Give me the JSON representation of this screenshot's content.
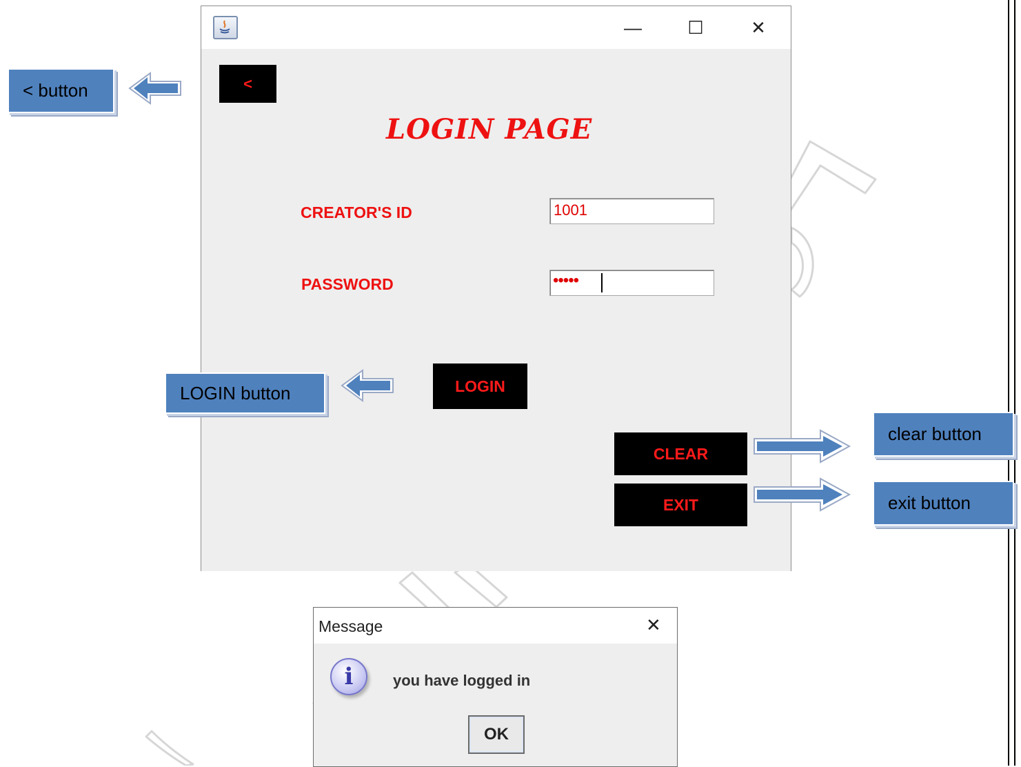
{
  "window": {
    "title": "",
    "back_label": "<",
    "heading": "LOGIN PAGE",
    "creator_id_label": "CREATOR'S ID",
    "creator_id_value": "1001",
    "password_label": "PASSWORD",
    "password_mask": "•••••",
    "login_label": "LOGIN",
    "clear_label": "CLEAR",
    "exit_label": "EXIT",
    "controls": {
      "minimize": "—",
      "maximize": "☐",
      "close": "✕"
    }
  },
  "callouts": {
    "back": "< button",
    "login": "LOGIN  button",
    "clear": "clear button",
    "exit": "exit button"
  },
  "dialog": {
    "title": "Message",
    "message": "you have logged in",
    "ok_label": "OK",
    "close": "✕"
  },
  "colors": {
    "accent_red": "#ee1111",
    "button_black": "#000000",
    "callout_blue": "#4f81bd",
    "window_bg": "#eeeeee"
  }
}
